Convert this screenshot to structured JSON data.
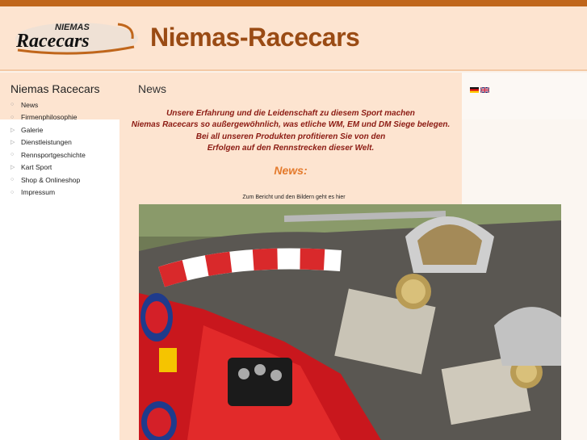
{
  "header": {
    "title": "Niemas-Racecars"
  },
  "logo": {
    "word_top": "NIEMAS",
    "word_bottom": "Racecars"
  },
  "sidebar": {
    "title": "Niemas Racecars",
    "items": [
      {
        "label": "News",
        "icon": "circle"
      },
      {
        "label": "Firmenphilosophie",
        "icon": "circle"
      },
      {
        "label": "Galerie",
        "icon": "triangle"
      },
      {
        "label": "Dienstleistungen",
        "icon": "triangle"
      },
      {
        "label": "Rennsportgeschichte",
        "icon": "circle"
      },
      {
        "label": "Kart Sport",
        "icon": "triangle"
      },
      {
        "label": "Shop & Onlineshop",
        "icon": "circle"
      },
      {
        "label": "Impressum",
        "icon": "circle"
      }
    ]
  },
  "content": {
    "title": "News",
    "intro_lines": [
      "Unsere Erfahrung und die Leidenschaft zu diesem Sport machen",
      "Niemas Racecars so außergewöhnlich, was etliche WM, EM und DM Siege belegen.",
      "Bei all unseren Produkten profitieren Sie von den",
      "Erfolgen auf den Rennstrecken dieser Welt."
    ],
    "news_heading": "News:",
    "report_link": "Zum Bericht und den Bildern geht es hier"
  },
  "language": {
    "flags": [
      "german-flag-icon",
      "english-flag-icon"
    ]
  },
  "colors": {
    "accent": "#c0661b",
    "title": "#9a4b14",
    "header_bg": "#fde4d0",
    "intro_text": "#8b1a12",
    "news_heading": "#e47a2c"
  }
}
